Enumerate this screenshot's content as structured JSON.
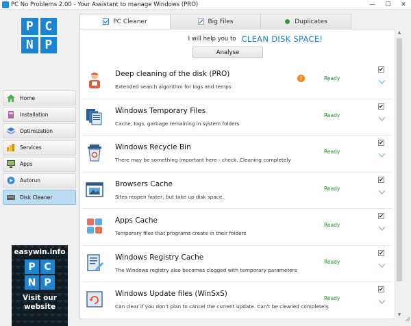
{
  "window": {
    "title": "PC No Problems 2.00 - Your Assistant to manage Windows (PRO)",
    "controls": [
      "—",
      "☐",
      "✕"
    ]
  },
  "logo": [
    "P",
    "C",
    "N",
    "P"
  ],
  "nav": [
    {
      "label": "Home",
      "icon": "home-icon",
      "color": "#4caf50"
    },
    {
      "label": "Installation",
      "icon": "installation-icon",
      "color": "#b06aa8"
    },
    {
      "label": "Optimization",
      "icon": "optimization-icon",
      "color": "#3a7bd5"
    },
    {
      "label": "Services",
      "icon": "services-icon",
      "color": "#e0a020"
    },
    {
      "label": "Apps",
      "icon": "apps-icon",
      "color": "#444"
    },
    {
      "label": "Autorun",
      "icon": "autorun-icon",
      "color": "#3f8fd8"
    },
    {
      "label": "Disk Cleaner",
      "icon": "disk-cleaner-icon",
      "color": "#555",
      "active": true
    }
  ],
  "ad": {
    "title": "easywin.info",
    "logo": [
      "P",
      "C",
      "N",
      "P"
    ],
    "line1": "Visit our",
    "line2": "website"
  },
  "tabs": [
    {
      "label": "PC Cleaner",
      "icon": "checkbox-icon",
      "active": true
    },
    {
      "label": "Big Files",
      "icon": "pencil-icon"
    },
    {
      "label": "Duplicates",
      "icon": "green-dot-icon"
    }
  ],
  "headline": {
    "pre": "I will help you to",
    "big": "CLEAN DISK SPACE!"
  },
  "analyse_label": "Analyse",
  "items": [
    {
      "title": "Deep cleaning of the disk (PRO)",
      "desc": "Extended search algorithm for logs and temps",
      "status": "Ready",
      "checked": "✔",
      "warn": "!",
      "icon": "worker-icon"
    },
    {
      "title": "Windows Temporary Files",
      "desc": "Cache, logs, garbage remaining in system folders",
      "status": "Ready",
      "checked": "✔",
      "icon": "documents-icon"
    },
    {
      "title": "Windows Recycle Bin",
      "desc": "There may be something important here - check. Cleaning completely",
      "status": "Ready",
      "checked": "✔",
      "icon": "recycle-bin-icon"
    },
    {
      "title": "Browsers Cache",
      "desc": "Sites reopen faster, but take up disk space.",
      "status": "Ready",
      "checked": "✔",
      "icon": "browser-icon"
    },
    {
      "title": "Apps Cache",
      "desc": "Temporary files that programs create in their folders",
      "status": "Ready",
      "checked": "✔",
      "icon": "apps-cache-icon"
    },
    {
      "title": "Windows Registry Cache",
      "desc": "The Windows registry also becomes clogged with temporary parameters",
      "status": "Ready",
      "checked": "✔",
      "icon": "registry-icon"
    },
    {
      "title": "Windows Update files (WinSxS)",
      "desc": "Can clear if you don't plan to cancel the current update. Can't be cleaned completely.",
      "status": "Ready",
      "checked": "✔",
      "icon": "windows-update-icon"
    }
  ]
}
